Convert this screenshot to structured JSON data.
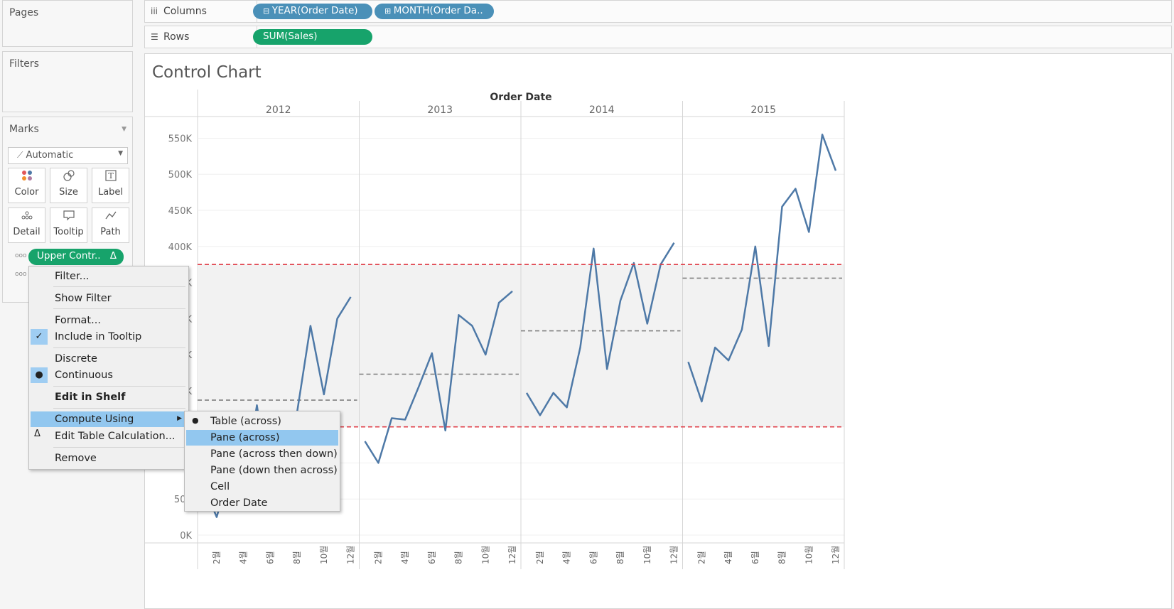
{
  "pages": {
    "title": "Pages"
  },
  "filters": {
    "title": "Filters"
  },
  "columns_shelf": {
    "label": "Columns",
    "icon": "columns-icon",
    "pills": [
      "YEAR(Order Date)",
      "MONTH(Order Da.."
    ]
  },
  "rows_shelf": {
    "label": "Rows",
    "icon": "rows-icon",
    "pills": [
      "SUM(Sales)"
    ]
  },
  "marks": {
    "title": "Marks",
    "mark_type": "Automatic",
    "buttons": [
      {
        "label": "Color",
        "icon": "color-icon"
      },
      {
        "label": "Size",
        "icon": "size-icon"
      },
      {
        "label": "Label",
        "icon": "label-icon"
      },
      {
        "label": "Detail",
        "icon": "detail-icon"
      },
      {
        "label": "Tooltip",
        "icon": "tooltip-icon"
      },
      {
        "label": "Path",
        "icon": "path-icon"
      }
    ],
    "field_pill": "Upper Contr..",
    "field_pill_badge": "Δ"
  },
  "context_menu": {
    "items": [
      "Filter...",
      "Show Filter",
      "Format...",
      "Include in Tooltip",
      "Discrete",
      "Continuous",
      "Edit in Shelf",
      "Compute Using",
      "Edit Table Calculation...",
      "Remove"
    ],
    "checked": "Include in Tooltip",
    "selected_radio": "Continuous",
    "bold": "Edit in Shelf",
    "highlighted": "Compute Using"
  },
  "submenu": {
    "items": [
      "Table (across)",
      "Pane (across)",
      "Pane (across then down)",
      "Pane (down then across)",
      "Cell",
      "Order Date"
    ],
    "selected": "Table (across)",
    "highlighted": "Pane (across)"
  },
  "colors": {
    "line": "#4e79a7",
    "control_limit": "#e0404a",
    "mean": "#808080",
    "band": "#f2f2f2",
    "accent_green": "#17a36b",
    "accent_blue": "#4a90b8",
    "menu_highlight": "#92c7ef"
  },
  "chart_data": {
    "type": "line",
    "title": "Control Chart",
    "column_header": "Order Date",
    "years": [
      "2012",
      "2013",
      "2014",
      "2015"
    ],
    "months": [
      1,
      2,
      3,
      4,
      5,
      6,
      7,
      8,
      9,
      10,
      11,
      12
    ],
    "x_tick_labels": [
      "2월",
      "4월",
      "6월",
      "8월",
      "10월",
      "12월"
    ],
    "y_ticks": [
      0,
      50000,
      100000,
      150000,
      200000,
      250000,
      300000,
      350000,
      400000,
      450000,
      500000,
      550000
    ],
    "y_tick_labels": [
      "0K",
      "50K",
      "100K",
      "150K",
      "200K",
      "250K",
      "300K",
      "350K",
      "400K",
      "450K",
      "500K",
      "550K"
    ],
    "ylim": [
      0,
      580000
    ],
    "series": [
      {
        "year": "2012",
        "values": [
          70000,
          25000,
          90000,
          60000,
          180000,
          55000,
          95000,
          170000,
          290000,
          195000,
          300000,
          330000
        ],
        "mean": 187000
      },
      {
        "year": "2013",
        "values": [
          130000,
          100000,
          162000,
          160000,
          205000,
          252000,
          145000,
          305000,
          290000,
          250000,
          322000,
          338000
        ],
        "mean": 223000
      },
      {
        "year": "2014",
        "values": [
          197000,
          166000,
          197000,
          177000,
          260000,
          397000,
          230000,
          325000,
          377000,
          293000,
          375000,
          405000
        ],
        "mean": 283000
      },
      {
        "year": "2015",
        "values": [
          240000,
          185000,
          260000,
          242000,
          285000,
          400000,
          262000,
          455000,
          480000,
          420000,
          555000,
          505000
        ],
        "mean": 356000
      }
    ],
    "upper_control_limit": 375000,
    "lower_control_limit": 150000,
    "grid": true
  }
}
